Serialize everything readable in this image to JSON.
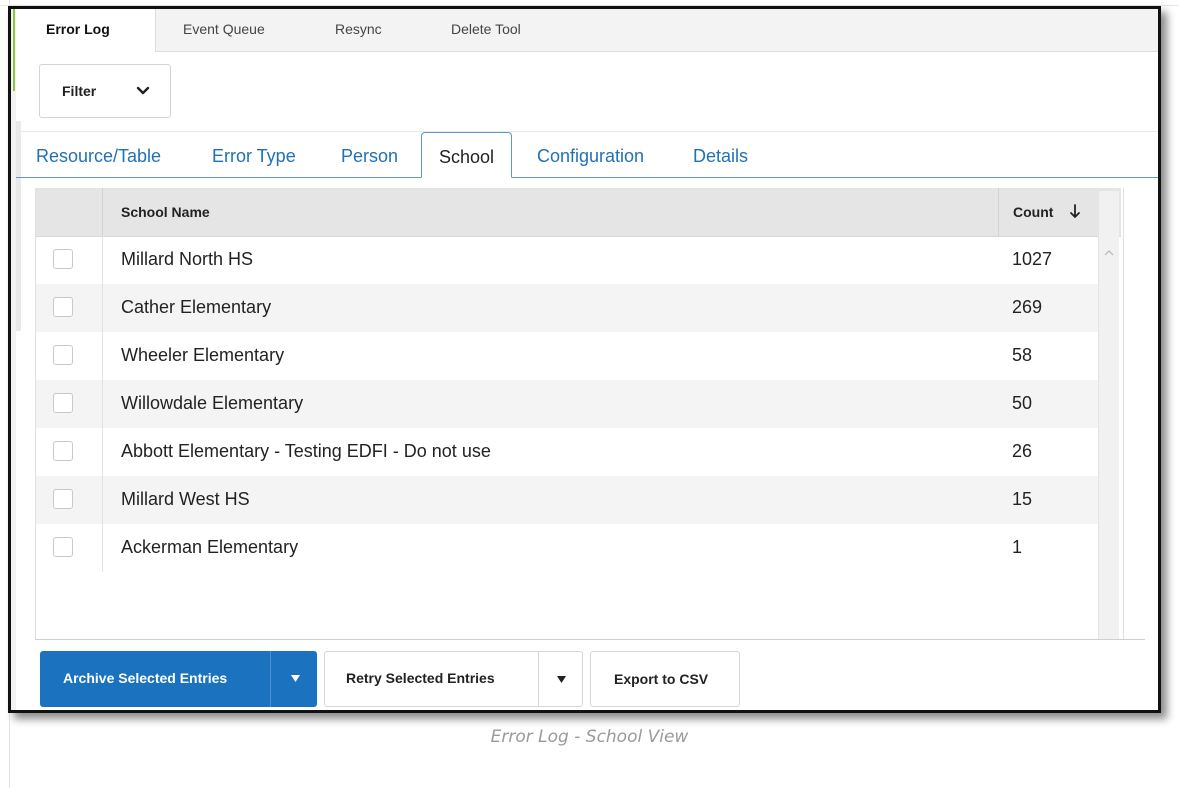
{
  "top_tabs": [
    {
      "label": "Error Log",
      "active": true
    },
    {
      "label": "Event Queue",
      "active": false
    },
    {
      "label": "Resync",
      "active": false
    },
    {
      "label": "Delete Tool",
      "active": false
    }
  ],
  "filter": {
    "label": "Filter",
    "icon": "chevron-down-icon"
  },
  "sub_tabs": [
    {
      "label": "Resource/Table",
      "active": false
    },
    {
      "label": "Error Type",
      "active": false
    },
    {
      "label": "Person",
      "active": false
    },
    {
      "label": "School",
      "active": true
    },
    {
      "label": "Configuration",
      "active": false
    },
    {
      "label": "Details",
      "active": false
    }
  ],
  "grid": {
    "columns": {
      "name": "School Name",
      "count": "Count",
      "sort_icon": "sort-descending-icon"
    },
    "rows": [
      {
        "name": "Millard North HS",
        "count": "1027"
      },
      {
        "name": "Cather Elementary",
        "count": "269"
      },
      {
        "name": "Wheeler Elementary",
        "count": "58"
      },
      {
        "name": "Willowdale Elementary",
        "count": "50"
      },
      {
        "name": "Abbott Elementary - Testing EDFI - Do not use",
        "count": "26"
      },
      {
        "name": "Millard West HS",
        "count": "15"
      },
      {
        "name": "Ackerman Elementary",
        "count": "1"
      }
    ]
  },
  "actions": {
    "archive": "Archive Selected Entries",
    "retry": "Retry Selected Entries",
    "export": "Export to CSV"
  },
  "caption": "Error Log - School View",
  "colors": {
    "accent": "#1b73c0",
    "tab_link": "#1f71b8",
    "frame": "#111111"
  }
}
